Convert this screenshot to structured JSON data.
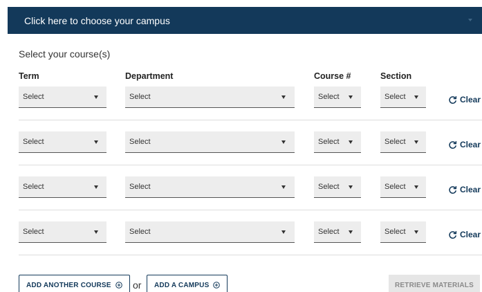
{
  "campus": {
    "label": "Click here to choose your campus"
  },
  "course_section": {
    "title": "Select your course(s)"
  },
  "columns": {
    "term": "Term",
    "department": "Department",
    "course": "Course #",
    "section": "Section"
  },
  "rows": [
    {
      "term": "Select",
      "department": "Select",
      "course": "Select",
      "section": "Select",
      "clear": "Clear"
    },
    {
      "term": "Select",
      "department": "Select",
      "course": "Select",
      "section": "Select",
      "clear": "Clear"
    },
    {
      "term": "Select",
      "department": "Select",
      "course": "Select",
      "section": "Select",
      "clear": "Clear"
    },
    {
      "term": "Select",
      "department": "Select",
      "course": "Select",
      "section": "Select",
      "clear": "Clear"
    }
  ],
  "actions": {
    "add_course": "ADD ANOTHER COURSE",
    "or": "or",
    "add_campus": "ADD A CAMPUS",
    "retrieve": "RETRIEVE MATERIALS"
  },
  "colors": {
    "brand": "#13395a",
    "disabled_bg": "#e6e6e6",
    "select_bg": "#ededed"
  },
  "icons": {
    "campus_caret": "caret-down-icon",
    "select_arrow": "caret-down-icon",
    "clear": "refresh-icon",
    "add": "plus-circle-icon"
  }
}
